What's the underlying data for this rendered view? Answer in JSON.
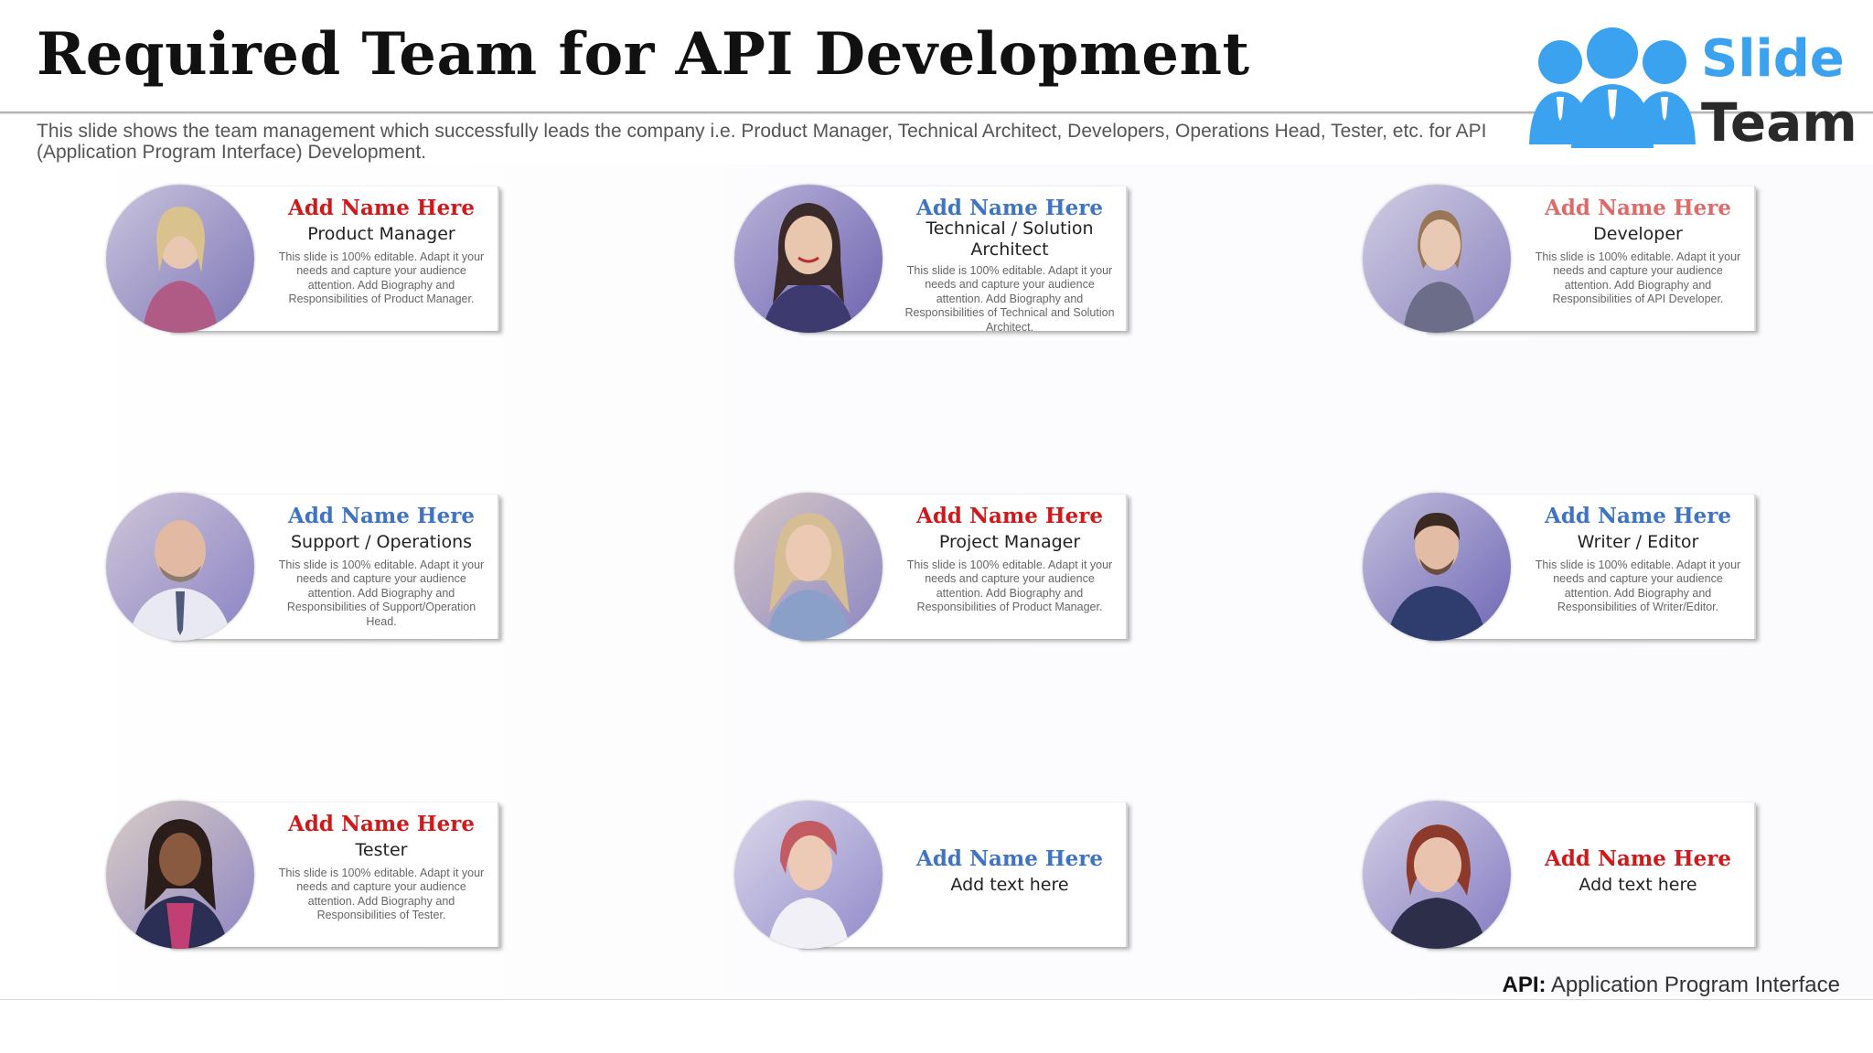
{
  "title": "Required Team for API Development",
  "subtitle": "This slide shows the team management which successfully leads the company i.e. Product Manager, Technical Architect, Developers, Operations Head, Tester, etc. for API (Application Program Interface) Development.",
  "logo": {
    "line1": "Slide",
    "line2": "Team",
    "icon": "people-group-icon"
  },
  "colors": {
    "red": "#d0191a",
    "blue": "#3f74c4",
    "pink": "#e06a6a",
    "logo_blue": "#3aa2ee"
  },
  "members": [
    {
      "name": "Add Name Here",
      "role": "Product Manager",
      "desc": "This slide is 100% editable. Adapt it your needs and capture your audience attention. Add Biography and Responsibilities of Product Manager.",
      "name_color": "#d0191a",
      "photo": "woman-photo"
    },
    {
      "name": "Add Name Here",
      "role": "Technical / Solution Architect",
      "desc": "This slide is 100% editable. Adapt it your needs and capture your audience attention. Add Biography and Responsibilities of Technical and Solution Architect.",
      "name_color": "#3f74c4",
      "photo": "woman-photo"
    },
    {
      "name": "Add Name Here",
      "role": "Developer",
      "desc": "This slide is 100% editable. Adapt it your needs and capture your audience attention. Add Biography and Responsibilities of API Developer.",
      "name_color": "#e06a6a",
      "photo": "woman-photo"
    },
    {
      "name": "Add Name Here",
      "role": "Support / Operations",
      "desc": "This slide is 100% editable. Adapt it your needs and capture your audience attention. Add Biography and Responsibilities of Support/Operation Head.",
      "name_color": "#3f74c4",
      "photo": "man-photo"
    },
    {
      "name": "Add Name Here",
      "role": "Project Manager",
      "desc": "This slide is 100% editable. Adapt it your needs and capture your audience attention. Add Biography and Responsibilities of Product Manager.",
      "name_color": "#d0191a",
      "photo": "woman-photo"
    },
    {
      "name": "Add Name Here",
      "role": "Writer / Editor",
      "desc": "This slide is 100% editable. Adapt it your needs and capture your audience attention. Add Biography and Responsibilities of Writer/Editor.",
      "name_color": "#3f74c4",
      "photo": "man-photo"
    },
    {
      "name": "Add Name Here",
      "role": "Tester",
      "desc": "This slide is 100% editable. Adapt it your needs and capture your audience attention. Add Biography and Responsibilities of Tester.",
      "name_color": "#d0191a",
      "photo": "woman-photo"
    },
    {
      "name": "Add Name Here",
      "role": "Add text here",
      "desc": "",
      "name_color": "#3f74c4",
      "photo": "woman-photo"
    },
    {
      "name": "Add Name Here",
      "role": "Add text here",
      "desc": "",
      "name_color": "#d0191a",
      "photo": "woman-photo"
    }
  ],
  "footer": {
    "abbr": "API:",
    "expansion": "Application Program Interface"
  }
}
